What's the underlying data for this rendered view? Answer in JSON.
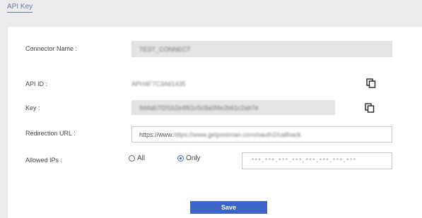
{
  "tabs": [
    {
      "label": "API Key",
      "active": true
    }
  ],
  "form": {
    "connector_name": {
      "label": "Connector Name :",
      "value": "TEST_CONNECT"
    },
    "api_id": {
      "label": "API ID :",
      "value": "APH4F7C3A61435"
    },
    "key": {
      "label": "Key :",
      "value": "9d4ab7f2f1b2e4f61c5c8a0f4e2b61c2ab7e"
    },
    "redirection_url": {
      "label": "Redirection URL :",
      "value": "https://www.getpostman.com/oauth2/callback"
    },
    "allowed_ips": {
      "label": "Allowed IPs :",
      "options": [
        {
          "label": "All",
          "selected": false
        },
        {
          "label": "Only",
          "selected": true
        }
      ],
      "placeholder": "***.***.***.***,***.***.***.***"
    }
  },
  "actions": {
    "save_label": "Save"
  },
  "icons": {
    "copy": "copy-icon"
  },
  "colors": {
    "accent": "#3b63c9",
    "tab_text": "#6b7a99",
    "readonly_bg": "#e4e4e4"
  }
}
